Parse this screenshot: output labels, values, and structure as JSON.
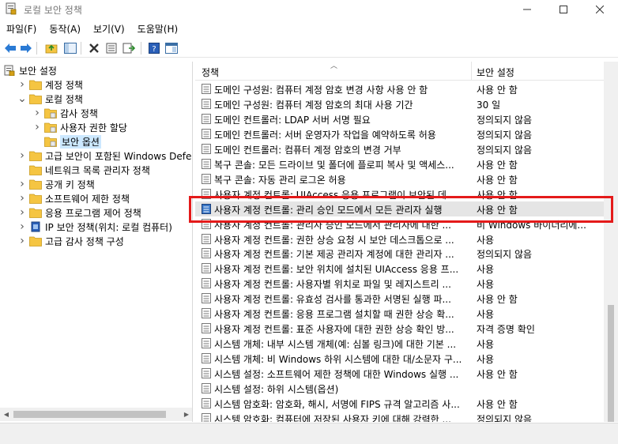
{
  "window": {
    "title": "로컬 보안 정책",
    "app_icon": "security-policy-icon",
    "controls": [
      "minimize-icon",
      "maximize-icon",
      "close-icon"
    ]
  },
  "menu": [
    "파일(F)",
    "동작(A)",
    "보기(V)",
    "도움말(H)"
  ],
  "toolbar": [
    "back-arrow-icon",
    "forward-arrow-icon",
    "up-folder-icon",
    "show-tree-icon",
    "delete-icon",
    "properties-icon",
    "export-list-icon",
    "help-icon",
    "console-view-icon"
  ],
  "tree": [
    {
      "label": "보안 설정",
      "level": 0,
      "expander": "",
      "icon": "security-settings-icon"
    },
    {
      "label": "계정 정책",
      "level": 1,
      "expander": "collapsed",
      "icon": "folder-icon"
    },
    {
      "label": "로컬 정책",
      "level": 1,
      "expander": "expanded",
      "icon": "folder-icon"
    },
    {
      "label": "감사 정책",
      "level": 2,
      "expander": "collapsed",
      "icon": "folder-icon"
    },
    {
      "label": "사용자 권한 할당",
      "level": 2,
      "expander": "collapsed",
      "icon": "folder-icon"
    },
    {
      "label": "보안 옵션",
      "level": 2,
      "expander": "",
      "icon": "folder-icon",
      "selected": true
    },
    {
      "label": "고급 보안이 포함된 Windows Defender",
      "level": 1,
      "expander": "collapsed",
      "icon": "folder-icon"
    },
    {
      "label": "네트워크 목록 관리자 정책",
      "level": 1,
      "expander": "",
      "icon": "folder-icon"
    },
    {
      "label": "공개 키 정책",
      "level": 1,
      "expander": "collapsed",
      "icon": "folder-icon"
    },
    {
      "label": "소프트웨어 제한 정책",
      "level": 1,
      "expander": "collapsed",
      "icon": "folder-icon"
    },
    {
      "label": "응용 프로그램 제어 정책",
      "level": 1,
      "expander": "collapsed",
      "icon": "folder-icon"
    },
    {
      "label": "IP 보안 정책(위치: 로컬 컴퓨터)",
      "level": 1,
      "expander": "collapsed",
      "icon": "ip-security-icon"
    },
    {
      "label": "고급 감사 정책 구성",
      "level": 1,
      "expander": "collapsed",
      "icon": "folder-icon"
    }
  ],
  "columns": {
    "policy": "정책",
    "setting": "보안 설정"
  },
  "rows": [
    {
      "policy": "도메인 구성원: 컴퓨터 계정 암호 변경 사항 사용 안 함",
      "setting": "사용 안 함"
    },
    {
      "policy": "도메인 구성원: 컴퓨터 계정 암호의 최대 사용 기간",
      "setting": "30 일"
    },
    {
      "policy": "도메인 컨트롤러: LDAP 서버 서명 필요",
      "setting": "정의되지 않음"
    },
    {
      "policy": "도메인 컨트롤러: 서버 운영자가 작업을 예약하도록 허용",
      "setting": "정의되지 않음"
    },
    {
      "policy": "도메인 컨트롤러: 컴퓨터 계정 암호의 변경 거부",
      "setting": "정의되지 않음"
    },
    {
      "policy": "복구 콘솔: 모든 드라이브 및 폴더에 플로피 복사 및 액세스...",
      "setting": "사용 안 함"
    },
    {
      "policy": "복구 콘솔: 자동 관리 로그온 허용",
      "setting": "사용 안 함"
    },
    {
      "policy": "사용자 계정 컨트롤: UIAccess 응용 프로그램이 보안된 데...",
      "setting": "사용 안 함"
    },
    {
      "policy": "사용자 계정 컨트롤: 관리 승인 모드에서 모든 관리자 실행",
      "setting": "사용 안 함",
      "highlight": true
    },
    {
      "policy": "사용자 계정 컨트롤: 관리자 승인 모드에서 관리자에 대한 ...",
      "setting": "비 Windows 바이너리에..."
    },
    {
      "policy": "사용자 계정 컨트롤: 권한 상승 요청 시 보안 데스크톱으로 ...",
      "setting": "사용"
    },
    {
      "policy": "사용자 계정 컨트롤: 기본 제공 관리자 계정에 대한 관리자 ...",
      "setting": "정의되지 않음"
    },
    {
      "policy": "사용자 계정 컨트롤: 보안 위치에 설치된 UIAccess 응용 프...",
      "setting": "사용"
    },
    {
      "policy": "사용자 계정 컨트롤: 사용자별 위치로 파일 및 레지스트리 ...",
      "setting": "사용"
    },
    {
      "policy": "사용자 계정 컨트롤: 유효성 검사를 통과한 서명된 실행 파...",
      "setting": "사용 안 함"
    },
    {
      "policy": "사용자 계정 컨트롤: 응용 프로그램 설치할 때 권한 상승 확...",
      "setting": "사용"
    },
    {
      "policy": "사용자 계정 컨트롤: 표준 사용자에 대한 권한 상승 확인 방...",
      "setting": "자격 증명 확인"
    },
    {
      "policy": "시스템 개체: 내부 시스템 개체(예: 심볼 링크)에 대한 기본 ...",
      "setting": "사용"
    },
    {
      "policy": "시스템 개체: 비 Windows 하위 시스템에 대한 대/소문자 구...",
      "setting": "사용"
    },
    {
      "policy": "시스템 설정: 소프트웨어 제한 정책에 대한 Windows 실행 ...",
      "setting": "사용 안 함"
    },
    {
      "policy": "시스템 설정: 하위 시스템(옵션)",
      "setting": ""
    },
    {
      "policy": "시스템 암호화: 암호화, 해시, 서명에 FIPS 규격 알고리즘 사...",
      "setting": "사용 안 함"
    },
    {
      "policy": "시스템 암호화: 컴퓨터에 저장된 사용자 키에 대해 강력한 ...",
      "setting": "정의되지 않음"
    }
  ],
  "colors": {
    "annotation": "#e41a1a",
    "selection": "#cce8ff",
    "highlight": "#e5e5e5",
    "folder": "#f5c542"
  }
}
